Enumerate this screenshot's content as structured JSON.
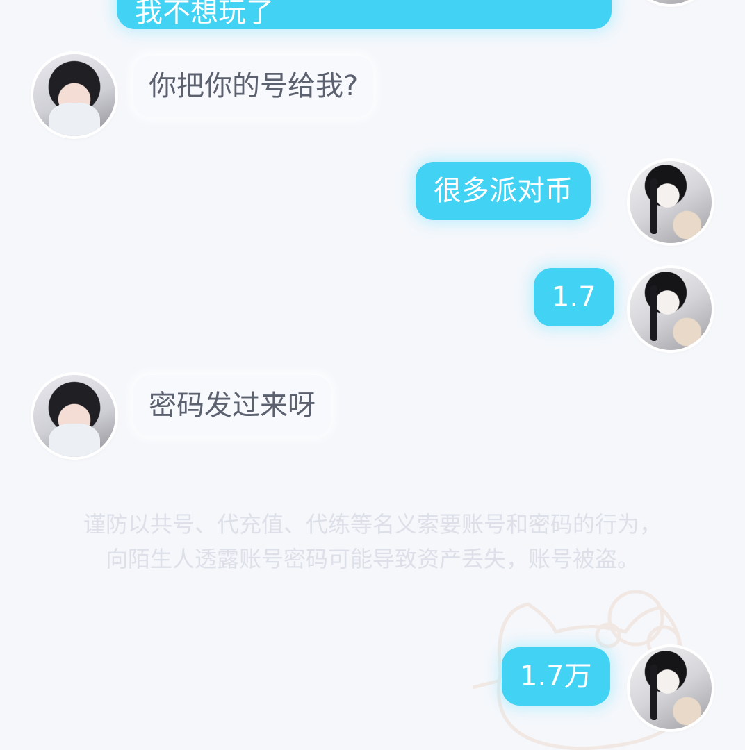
{
  "messages": [
    {
      "side": "out",
      "text": "我不想玩了"
    },
    {
      "side": "in",
      "text": "你把你的号给我?"
    },
    {
      "side": "out",
      "text": "很多派对币"
    },
    {
      "side": "out",
      "text": "1.7"
    },
    {
      "side": "in",
      "text": "密码发过来呀"
    },
    {
      "side": "out",
      "text": "1.7万"
    }
  ],
  "notice": "谨防以共号、代充值、代练等名义索要账号和密码的行为，向陌生人透露账号密码可能导致资产丢失，账号被盗。",
  "colors": {
    "outgoing_bubble": "#42d2f4",
    "incoming_bubble": "#f8f9fc",
    "background": "#f5f7fb"
  }
}
